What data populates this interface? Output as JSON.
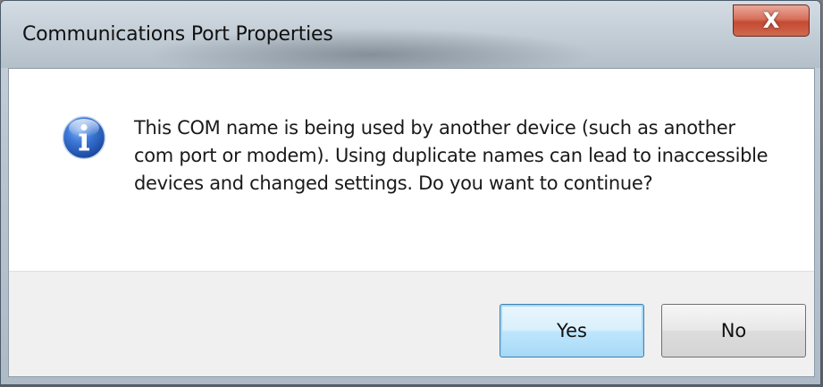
{
  "window": {
    "title": "Communications Port Properties",
    "close_symbol": "X",
    "close_icon": "close-icon"
  },
  "message": {
    "icon": "info-icon",
    "text": "This COM name is being used by another device (such as another com port or modem).  Using duplicate names can lead to inaccessible devices and changed settings.  Do you want to continue?"
  },
  "buttons": {
    "yes_label": "Yes",
    "no_label": "No",
    "default": "Yes"
  },
  "colors": {
    "info_icon_blue": "#2a63c4",
    "close_button_red": "#c44a33",
    "default_button_border": "#3c7fb1"
  }
}
